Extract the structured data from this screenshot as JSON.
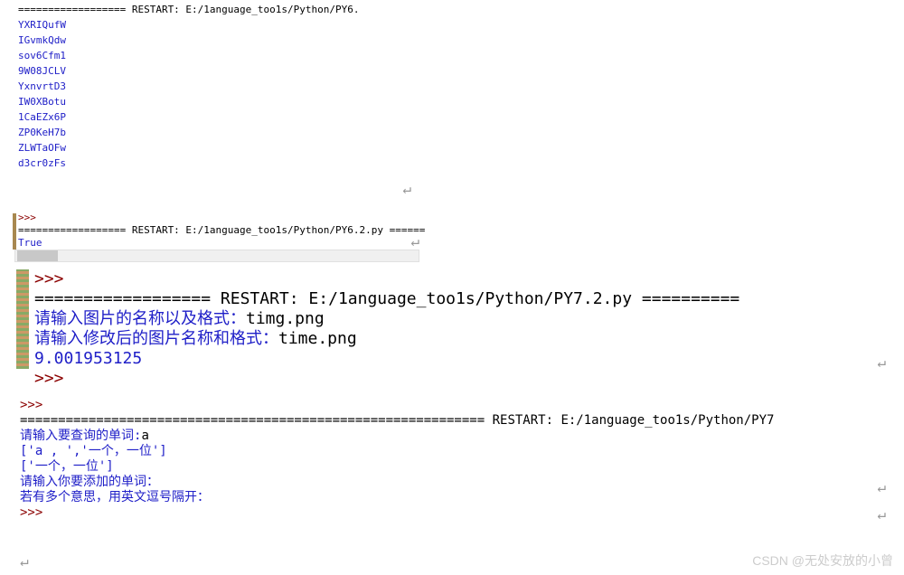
{
  "block1": {
    "restart_line": "================== RESTART: E:/1anguage_too1s/Python/PY6.",
    "outputs": [
      "YXRIQufW",
      "IGvmkQdw",
      "sov6Cfm1",
      "9W08JCLV",
      "YxnvrtD3",
      "IW0XBotu",
      "1CaEZx6P",
      "ZP0KeH7b",
      "ZLWTaOFw",
      "d3cr0zFs"
    ]
  },
  "block2": {
    "prompt1": ">>>",
    "restart_line": "================== RESTART: E:/1anguage_too1s/Python/PY6.2.py ======",
    "output": "True",
    "prompt2": ">>>"
  },
  "block3": {
    "prompt_top": ">>>",
    "restart_line": "================== RESTART: E:/1anguage_too1s/Python/PY7.2.py ==========",
    "line1_label": "请输入图片的名称以及格式：",
    "line1_value": "timg.png",
    "line2_label": "请输入修改后的图片名称和格式：",
    "line2_value": "time.png",
    "number_out": "9.001953125",
    "prompt_bottom": ">>>"
  },
  "block4": {
    "prompt_top": ">>>",
    "restart_line": "============================================================= RESTART: E:/1anguage_too1s/Python/PY7",
    "line1_label": "请输入要查询的单词:",
    "line1_value": "a",
    "list1": "['a , ','一个，一位']",
    "list2": "['一个，一位']",
    "line3": "请输入你要添加的单词：",
    "line4": "若有多个意思，用英文逗号隔开：",
    "prompt_bottom": ">>>"
  },
  "watermark": "CSDN @无处安放的小曾",
  "enter_symbol": "↵"
}
